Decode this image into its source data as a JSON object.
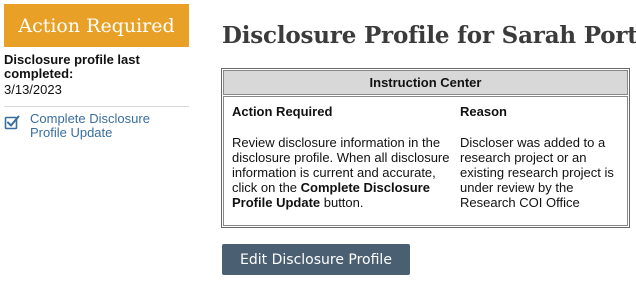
{
  "sidebar": {
    "banner": "Action Required",
    "last_completed_label": "Disclosure profile last completed:",
    "last_completed_date": "3/13/2023",
    "task_icon": "checkbox-checked-icon",
    "task_label": "Complete Disclosure Profile Update"
  },
  "page": {
    "title": "Disclosure Profile for Sarah Porter"
  },
  "instruction_center": {
    "header": "Instruction Center",
    "action_heading": "Action Required",
    "reason_heading": "Reason",
    "action_text_before": "Review disclosure information in the disclosure profile. When all disclosure information is current and accurate, click on the ",
    "action_text_bold": "Complete Disclosure Profile Update",
    "action_text_after": " button.",
    "reason_text": "Discloser was added to a research project or an existing research project is under review by the Research COI Office"
  },
  "actions": {
    "edit_button": "Edit Disclosure Profile"
  },
  "colors": {
    "banner": "#e8a126",
    "link": "#3a6e9e",
    "button": "#4b5f73",
    "header_bg": "#d8d8d8"
  }
}
